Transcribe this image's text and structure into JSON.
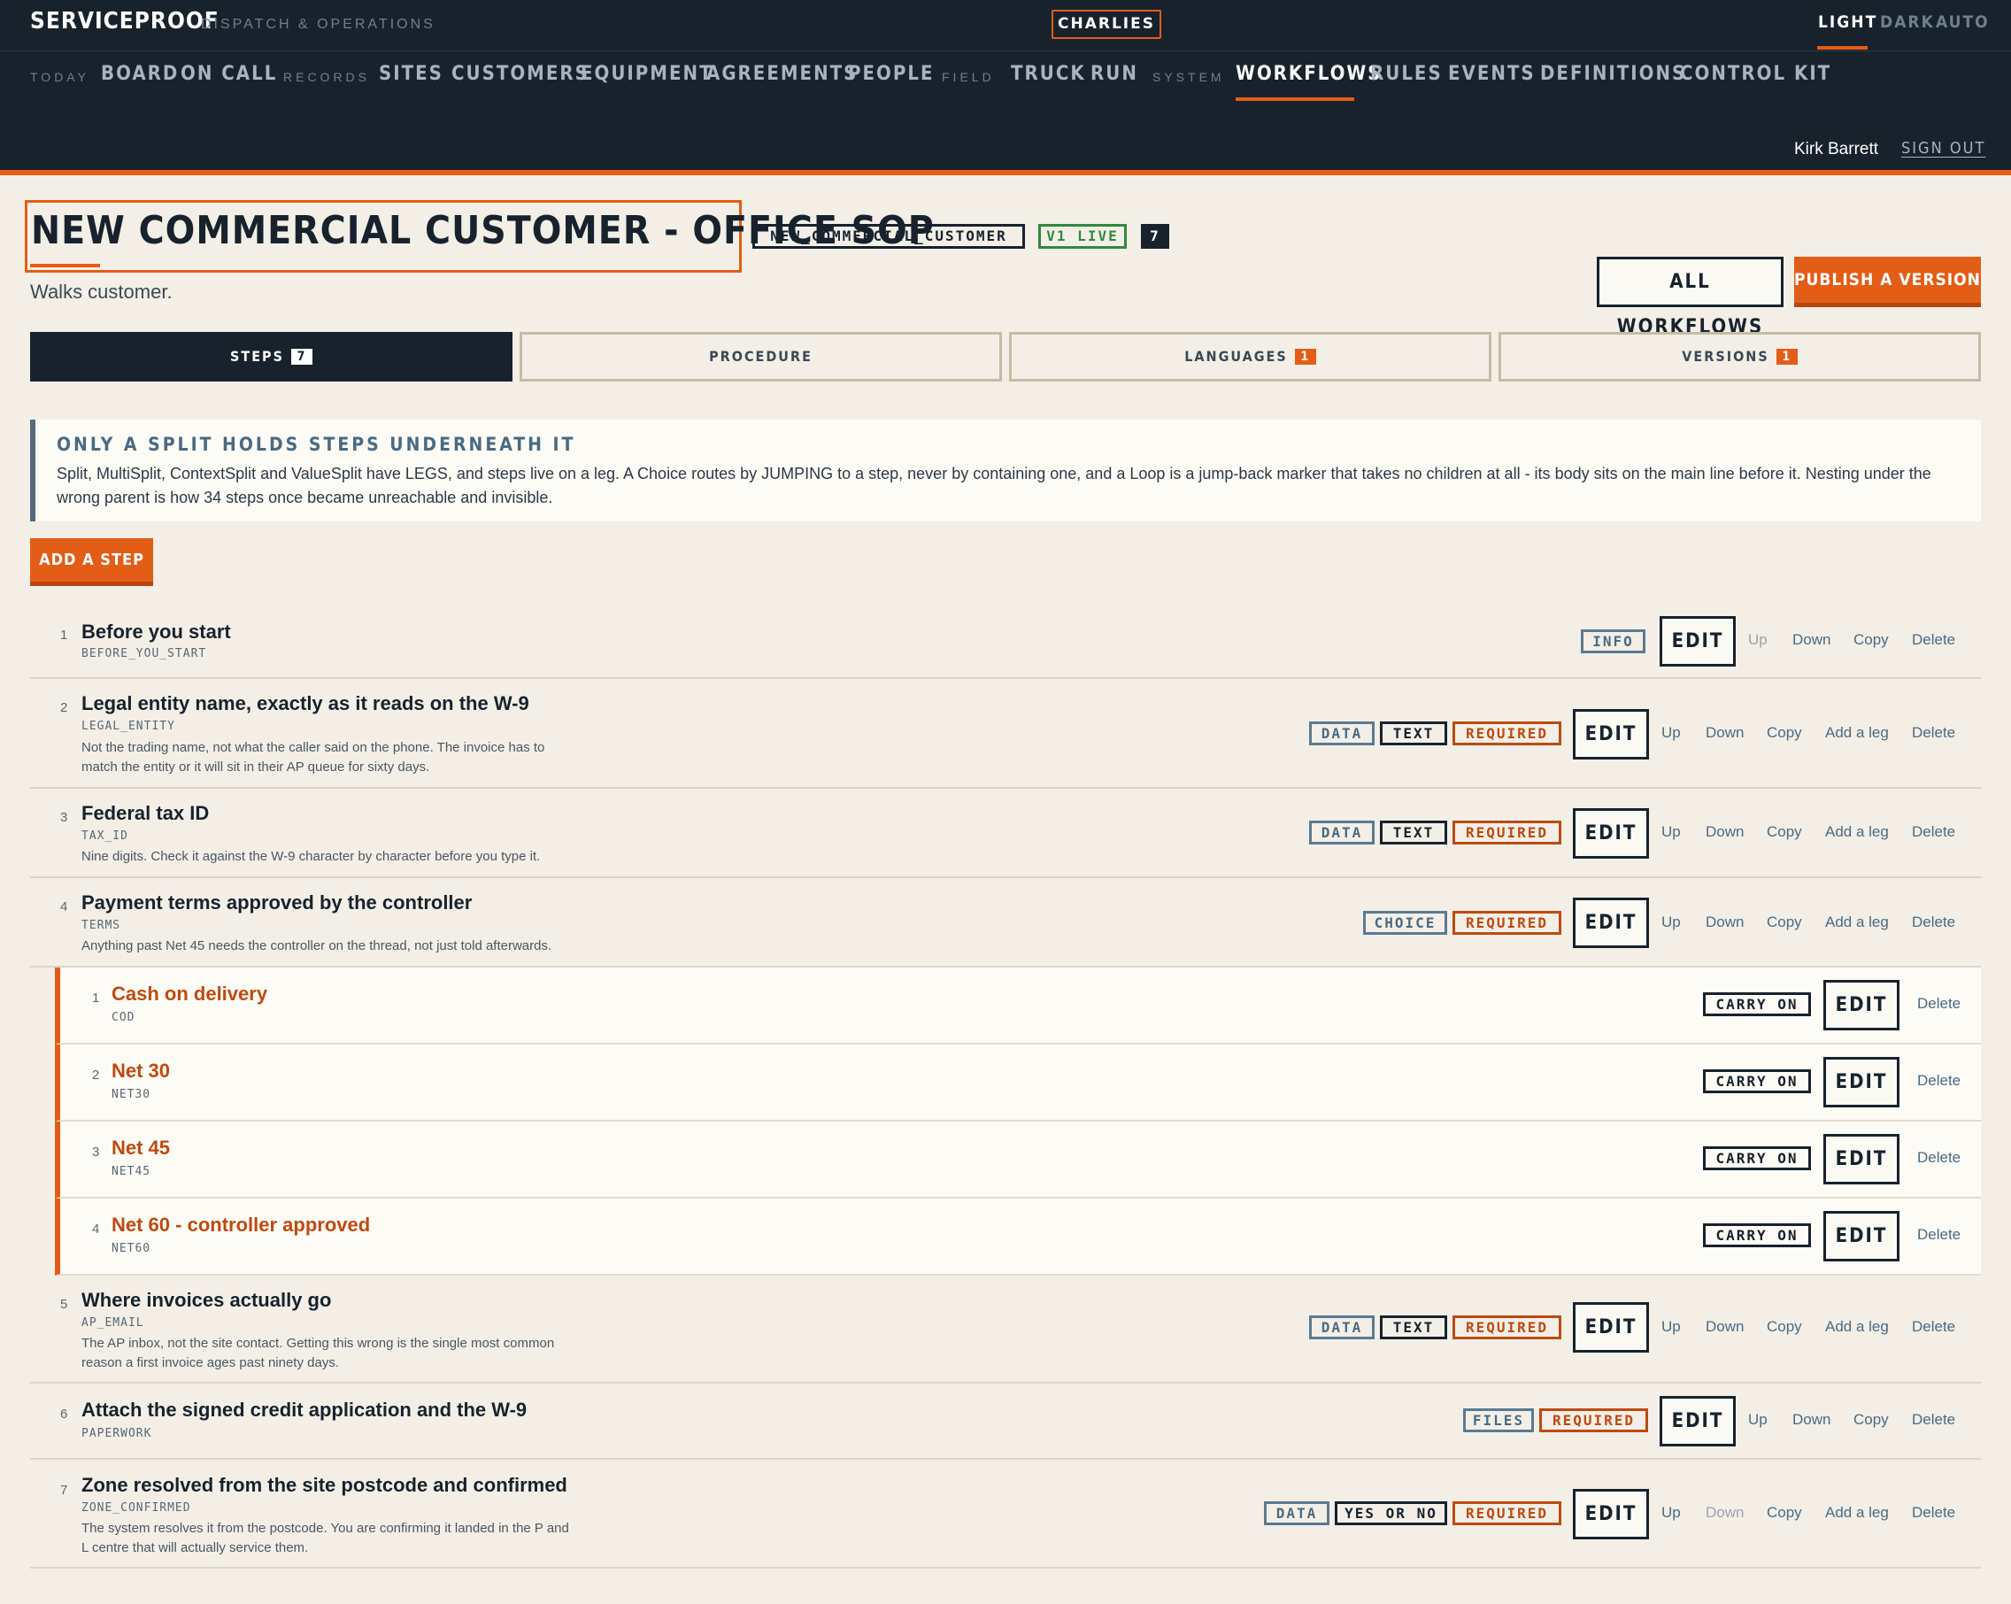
{
  "app": {
    "brand": "SERVICEPROOF",
    "brand_sub": "DISPATCH & OPERATIONS",
    "org": "CHARLIES"
  },
  "theme": {
    "light": "LIGHT",
    "dark": "DARK",
    "auto": "AUTO",
    "selected": "LIGHT"
  },
  "nav": {
    "groups": {
      "today": "TODAY",
      "records": "RECORDS",
      "field": "FIELD",
      "system": "SYSTEM"
    },
    "items": [
      "BOARD",
      "ON CALL",
      "SITES",
      "CUSTOMERS",
      "EQUIPMENT",
      "AGREEMENTS",
      "PEOPLE",
      "TRUCK",
      "RUN",
      "WORKFLOWS",
      "RULES",
      "EVENTS",
      "DEFINITIONS",
      "CONTROL KIT"
    ],
    "active": "WORKFLOWS"
  },
  "user": {
    "name": "Kirk Barrett",
    "signout": "SIGN OUT"
  },
  "workflow": {
    "title": "NEW COMMERCIAL CUSTOMER - OFFICE SOP",
    "key": "NEW_COMMERCIAL_CUSTOMER",
    "version_status": "V1 LIVE",
    "step_count": "7",
    "description": "Walks customer.",
    "all_workflows": "ALL WORKFLOWS",
    "publish": "PUBLISH A VERSION"
  },
  "tabs": [
    {
      "label": "STEPS",
      "badge": "7"
    },
    {
      "label": "PROCEDURE",
      "badge": ""
    },
    {
      "label": "LANGUAGES",
      "badge": "1"
    },
    {
      "label": "VERSIONS",
      "badge": "1"
    }
  ],
  "notice": {
    "title": "ONLY A SPLIT HOLDS STEPS UNDERNEATH IT",
    "body": "Split, MultiSplit, ContextSplit and ValueSplit have LEGS, and steps live on a leg. A Choice routes by JUMPING to a step, never by containing one, and a Loop is a jump-back marker that takes no children at all - its body sits on the main line before it. Nesting under the wrong parent is how 34 steps once became unreachable and invisible."
  },
  "add_step": "ADD A STEP",
  "labels": {
    "edit": "EDIT",
    "up": "Up",
    "down": "Down",
    "copy": "Copy",
    "add_leg": "Add a leg",
    "delete": "Delete",
    "info": "INFO",
    "data": "DATA",
    "text": "TEXT",
    "required": "REQUIRED",
    "choice": "CHOICE",
    "files": "FILES",
    "yes_or_no": "YES OR NO",
    "carry_on": "CARRY ON"
  },
  "steps": [
    {
      "num": "1",
      "title": "Before you start",
      "key": "BEFORE_YOU_START",
      "desc": ""
    },
    {
      "num": "2",
      "title": "Legal entity name, exactly as it reads on the W-9",
      "key": "LEGAL_ENTITY",
      "desc": "Not the trading name, not what the caller said on the phone. The invoice has to match the entity or it will sit in their AP queue for sixty days."
    },
    {
      "num": "3",
      "title": "Federal tax ID",
      "key": "TAX_ID",
      "desc": "Nine digits. Check it against the W-9 character by character before you type it."
    },
    {
      "num": "4",
      "title": "Payment terms approved by the controller",
      "key": "TERMS",
      "desc": "Anything past Net 45 needs the controller on the thread, not just told afterwards."
    },
    {
      "num": "5",
      "title": "Where invoices actually go",
      "key": "AP_EMAIL",
      "desc": "The AP inbox, not the site contact. Getting this wrong is the single most common reason a first invoice ages past ninety days."
    },
    {
      "num": "6",
      "title": "Attach the signed credit application and the W-9",
      "key": "PAPERWORK",
      "desc": ""
    },
    {
      "num": "7",
      "title": "Zone resolved from the site postcode and confirmed",
      "key": "ZONE_CONFIRMED",
      "desc": "The system resolves it from the postcode. You are confirming it landed in the P and L centre that will actually service them."
    }
  ],
  "legs": [
    {
      "num": "1",
      "title": "Cash on delivery",
      "key": "COD"
    },
    {
      "num": "2",
      "title": "Net 30",
      "key": "NET30"
    },
    {
      "num": "3",
      "title": "Net 45",
      "key": "NET45"
    },
    {
      "num": "4",
      "title": "Net 60 - controller approved",
      "key": "NET60"
    }
  ]
}
